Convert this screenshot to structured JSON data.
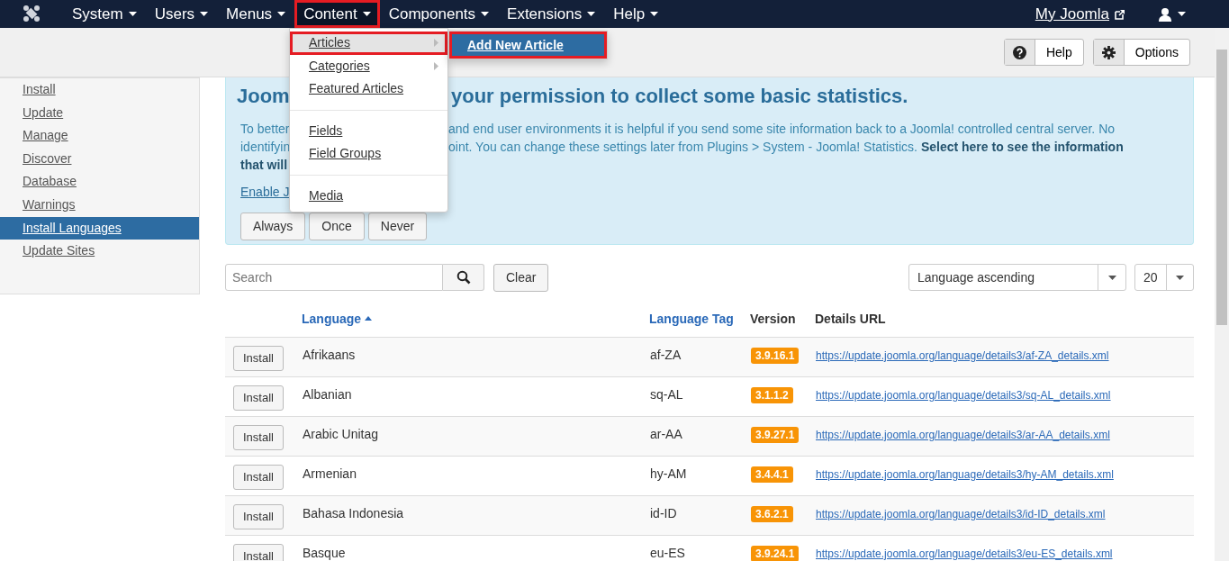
{
  "navbar": {
    "items": [
      {
        "label": "System",
        "selected": false,
        "highlighted": false
      },
      {
        "label": "Users",
        "selected": false,
        "highlighted": false
      },
      {
        "label": "Menus",
        "selected": false,
        "highlighted": false
      },
      {
        "label": "Content",
        "selected": true,
        "highlighted": true
      },
      {
        "label": "Components",
        "selected": false,
        "highlighted": false
      },
      {
        "label": "Extensions",
        "selected": false,
        "highlighted": false
      },
      {
        "label": "Help",
        "selected": false,
        "highlighted": false
      }
    ],
    "site_link": "My Joomla"
  },
  "content_menu": {
    "items": [
      {
        "kind": "item",
        "label": "Articles",
        "hovered": true,
        "submenu": true,
        "highlighted": true
      },
      {
        "kind": "item",
        "label": "Categories",
        "hovered": false,
        "submenu": true,
        "highlighted": false
      },
      {
        "kind": "item",
        "label": "Featured Articles",
        "hovered": false,
        "submenu": false,
        "highlighted": false
      },
      {
        "kind": "divider"
      },
      {
        "kind": "item",
        "label": "Fields",
        "hovered": false,
        "submenu": false,
        "highlighted": false
      },
      {
        "kind": "item",
        "label": "Field Groups",
        "hovered": false,
        "submenu": false,
        "highlighted": false
      },
      {
        "kind": "divider"
      },
      {
        "kind": "item",
        "label": "Media",
        "hovered": false,
        "submenu": false,
        "highlighted": false
      }
    ]
  },
  "submenu": {
    "items": [
      {
        "label": "Add New Article",
        "selected": true,
        "highlighted": true
      }
    ]
  },
  "toolbar": {
    "buttons": [
      {
        "kind": "help",
        "label": "Help"
      },
      {
        "kind": "options",
        "label": "Options"
      }
    ]
  },
  "sidebar": {
    "items": [
      {
        "label": "Install",
        "selected": false
      },
      {
        "label": "Update",
        "selected": false
      },
      {
        "label": "Manage",
        "selected": false
      },
      {
        "label": "Discover",
        "selected": false
      },
      {
        "label": "Database",
        "selected": false
      },
      {
        "label": "Warnings",
        "selected": false
      },
      {
        "label": "Install Languages",
        "selected": true
      },
      {
        "label": "Update Sites",
        "selected": false
      }
    ]
  },
  "message": {
    "heading": [
      "Joom",
      "your permission to collect some basic statistics."
    ],
    "lines": [
      {
        "parts": [
          "To better",
          "and end user environments it is helpful if you send some site information back to a Joomla! controlled central server. No"
        ],
        "bold": false
      },
      {
        "parts": [
          "identifyin",
          "oint. You can change these settings later from Plugins > System - Joomla! Statistics. **Select here to see the information**"
        ],
        "bold": false
      },
      {
        "parts": [
          "that will"
        ],
        "bold": true
      }
    ],
    "link": "Enable J",
    "buttons": [
      "Always",
      "Once",
      "Never"
    ]
  },
  "filters": {
    "search_placeholder": "Search",
    "clear": "Clear",
    "ordering": "Language ascending",
    "limit": "20"
  },
  "table": {
    "columns": [
      {
        "label": "Language",
        "sortable": true,
        "sorted": true
      },
      {
        "label": "Language Tag",
        "sortable": true,
        "sorted": false
      },
      {
        "label": "Version",
        "sortable": false,
        "sorted": false
      },
      {
        "label": "Details URL",
        "sortable": false,
        "sorted": false
      }
    ],
    "rows": [
      {
        "action": "Install",
        "language": "Afrikaans",
        "tag": "af-ZA",
        "version": "3.9.16.1",
        "url": "https://update.joomla.org/language/details3/af-ZA_details.xml"
      },
      {
        "action": "Install",
        "language": "Albanian",
        "tag": "sq-AL",
        "version": "3.1.1.2",
        "url": "https://update.joomla.org/language/details3/sq-AL_details.xml"
      },
      {
        "action": "Install",
        "language": "Arabic Unitag",
        "tag": "ar-AA",
        "version": "3.9.27.1",
        "url": "https://update.joomla.org/language/details3/ar-AA_details.xml"
      },
      {
        "action": "Install",
        "language": "Armenian",
        "tag": "hy-AM",
        "version": "3.4.4.1",
        "url": "https://update.joomla.org/language/details3/hy-AM_details.xml"
      },
      {
        "action": "Install",
        "language": "Bahasa Indonesia",
        "tag": "id-ID",
        "version": "3.6.2.1",
        "url": "https://update.joomla.org/language/details3/id-ID_details.xml"
      },
      {
        "action": "Install",
        "language": "Basque",
        "tag": "eu-ES",
        "version": "3.9.24.1",
        "url": "https://update.joomla.org/language/details3/eu-ES_details.xml"
      }
    ]
  }
}
